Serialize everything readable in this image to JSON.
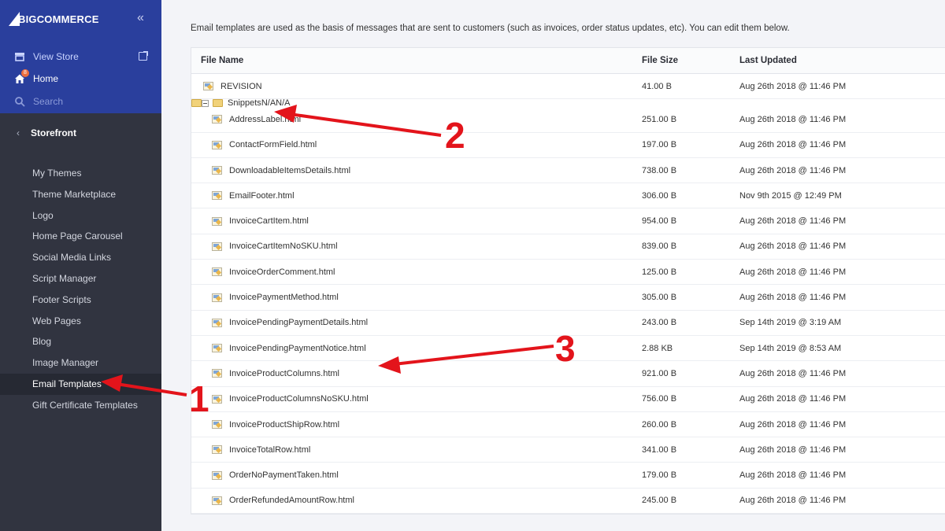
{
  "sidebar": {
    "brand": "BIGCOMMERCE",
    "top_links": [
      {
        "label": "View Store",
        "icon": "store-icon"
      },
      {
        "label": "Home",
        "icon": "home-icon",
        "badge": "8"
      },
      {
        "label": "Search",
        "icon": "search-icon"
      }
    ],
    "section_title": "Storefront",
    "menu": [
      "My Themes",
      "Theme Marketplace",
      "Logo",
      "Home Page Carousel",
      "Social Media Links",
      "Script Manager",
      "Footer Scripts",
      "Web Pages",
      "Blog",
      "Image Manager",
      "Email Templates",
      "Gift Certificate Templates"
    ],
    "active_item": "Email Templates"
  },
  "main": {
    "intro": "Email templates are used as the basis of messages that are sent to customers (such as invoices, order status updates, etc). You can edit them below.",
    "columns": [
      "File Name",
      "File Size",
      "Last Updated"
    ],
    "rows": [
      {
        "name": "REVISION",
        "size": "41.00 B",
        "updated": "Aug 26th 2018 @ 11:46 PM",
        "kind": "root"
      },
      {
        "name": "Snippets",
        "size": "N/A",
        "updated": "N/A",
        "kind": "folder"
      },
      {
        "name": "AddressLabel.html",
        "size": "251.00 B",
        "updated": "Aug 26th 2018 @ 11:46 PM",
        "kind": "child"
      },
      {
        "name": "ContactFormField.html",
        "size": "197.00 B",
        "updated": "Aug 26th 2018 @ 11:46 PM",
        "kind": "child"
      },
      {
        "name": "DownloadableItemsDetails.html",
        "size": "738.00 B",
        "updated": "Aug 26th 2018 @ 11:46 PM",
        "kind": "child"
      },
      {
        "name": "EmailFooter.html",
        "size": "306.00 B",
        "updated": "Nov 9th 2015 @ 12:49 PM",
        "kind": "child"
      },
      {
        "name": "InvoiceCartItem.html",
        "size": "954.00 B",
        "updated": "Aug 26th 2018 @ 11:46 PM",
        "kind": "child"
      },
      {
        "name": "InvoiceCartItemNoSKU.html",
        "size": "839.00 B",
        "updated": "Aug 26th 2018 @ 11:46 PM",
        "kind": "child"
      },
      {
        "name": "InvoiceOrderComment.html",
        "size": "125.00 B",
        "updated": "Aug 26th 2018 @ 11:46 PM",
        "kind": "child"
      },
      {
        "name": "InvoicePaymentMethod.html",
        "size": "305.00 B",
        "updated": "Aug 26th 2018 @ 11:46 PM",
        "kind": "child"
      },
      {
        "name": "InvoicePendingPaymentDetails.html",
        "size": "243.00 B",
        "updated": "Sep 14th 2019 @ 3:19 AM",
        "kind": "child"
      },
      {
        "name": "InvoicePendingPaymentNotice.html",
        "size": "2.88 KB",
        "updated": "Sep 14th 2019 @ 8:53 AM",
        "kind": "child"
      },
      {
        "name": "InvoiceProductColumns.html",
        "size": "921.00 B",
        "updated": "Aug 26th 2018 @ 11:46 PM",
        "kind": "child"
      },
      {
        "name": "InvoiceProductColumnsNoSKU.html",
        "size": "756.00 B",
        "updated": "Aug 26th 2018 @ 11:46 PM",
        "kind": "child"
      },
      {
        "name": "InvoiceProductShipRow.html",
        "size": "260.00 B",
        "updated": "Aug 26th 2018 @ 11:46 PM",
        "kind": "child"
      },
      {
        "name": "InvoiceTotalRow.html",
        "size": "341.00 B",
        "updated": "Aug 26th 2018 @ 11:46 PM",
        "kind": "child"
      },
      {
        "name": "OrderNoPaymentTaken.html",
        "size": "179.00 B",
        "updated": "Aug 26th 2018 @ 11:46 PM",
        "kind": "child"
      },
      {
        "name": "OrderRefundedAmountRow.html",
        "size": "245.00 B",
        "updated": "Aug 26th 2018 @ 11:46 PM",
        "kind": "child"
      }
    ]
  },
  "annotations": {
    "color": "#e3141b",
    "labels": [
      "1",
      "2",
      "3"
    ]
  }
}
